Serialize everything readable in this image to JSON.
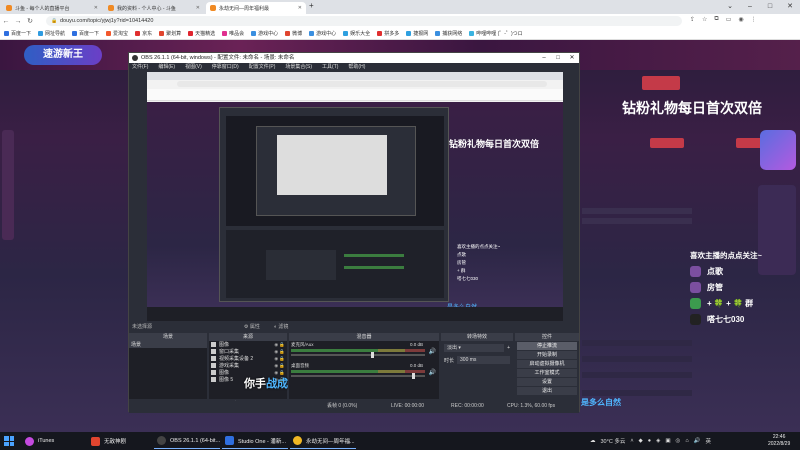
{
  "chrome": {
    "tabs": [
      {
        "title": "斗鱼 - 每个人的直播平台",
        "color": "#f08a24"
      },
      {
        "title": "我的资料 - 个人中心 - 斗鱼",
        "color": "#f08a24"
      },
      {
        "title": "永劫无间—周年福利最",
        "color": "#f08a24"
      }
    ],
    "new_tab": "+",
    "url": "douyu.com/topic/yjwj1y?rid=10414420",
    "bookmarks": [
      {
        "label": "百度一下",
        "color": "#2f6fe0"
      },
      {
        "label": "网址导航",
        "color": "#2f9be0"
      },
      {
        "label": "百度一下",
        "color": "#2f6fe0"
      },
      {
        "label": "爱淘宝",
        "color": "#f2582c"
      },
      {
        "label": "京东",
        "color": "#e02f2f"
      },
      {
        "label": "聚划算",
        "color": "#e0452f"
      },
      {
        "label": "天猫精选",
        "color": "#e0252f"
      },
      {
        "label": "唯品会",
        "color": "#e02f8f"
      },
      {
        "label": "游戏中心",
        "color": "#3a8fe0"
      },
      {
        "label": "微博",
        "color": "#e0452f"
      },
      {
        "label": "游戏中心",
        "color": "#3a8fe0"
      },
      {
        "label": "娱乐大全",
        "color": "#2fa0e0"
      },
      {
        "label": "拼多多",
        "color": "#e02f2f"
      },
      {
        "label": "捷报网",
        "color": "#2fa0e0"
      },
      {
        "label": "捕获网络",
        "color": "#3a8fe0"
      },
      {
        "label": "哔哩哔哩 (゜-゜)つロ",
        "color": "#3ab3e0"
      }
    ]
  },
  "douyu": {
    "logo": "速游新王",
    "banner": "钻粉礼物每日首次双倍",
    "panel_title": "喜欢主播的点点关注~",
    "panel_items": [
      "点歌",
      "房管",
      "+ 🍀 + 🍀 群",
      "嗒七七030"
    ],
    "watermark": "是多么自然"
  },
  "obs": {
    "title": "OBS 26.1.1 (64-bit, windows) - 配置文件: 未命名 - 场景: 未命名",
    "menu": [
      "文件(F)",
      "编辑(E)",
      "视图(V)",
      "停靠窗口(D)",
      "配置文件(P)",
      "场景集合(S)",
      "工具(T)",
      "帮助(H)"
    ],
    "preview_banner": "钻粉礼物每日首次双倍",
    "preview_panel": [
      "喜欢主播的点点关注~",
      "点歌",
      "房管",
      "+ 群",
      "嗒七七030"
    ],
    "preview_watermark": "是多么自然",
    "source_label": "未选择源",
    "toggle_props": "属性",
    "toggle_filters": "滤镜",
    "dock_titles": {
      "scenes": "场景",
      "sources": "来源",
      "mixer": "混音器",
      "transitions": "转场特效",
      "controls": "控件"
    },
    "scenes": [
      "场景"
    ],
    "sources": [
      "图像",
      "窗口采集",
      "视频采集设备 2",
      "游戏采集",
      "图像",
      "图像 5"
    ],
    "mixer": [
      {
        "name": "麦克风/Aux",
        "db": "0.0 dB",
        "level": 0.6
      },
      {
        "name": "桌面音频",
        "db": "0.0 dB",
        "level": 0.9
      }
    ],
    "transition": {
      "type": "淡出",
      "duration_label": "时长",
      "duration": "300 ms"
    },
    "controls": [
      "停止推流",
      "开始录制",
      "启动虚拟摄像机",
      "工作室模式",
      "设置",
      "退出"
    ],
    "status": {
      "live": "LIVE: 00:00:00",
      "rec": "REC: 00:00:00",
      "cpu": "CPU: 1.3%, 60.00 fps",
      "dropped": "丢帧 0 (0.0%)",
      "kbps": "kb/s: 0"
    },
    "subtitle_white": "你手",
    "subtitle_blue": "战成"
  },
  "taskbar": {
    "apps": [
      {
        "label": "iTunes",
        "color": "#c44ae0"
      },
      {
        "label": "无敌神剧",
        "color": "#e0452f"
      },
      {
        "label": "OBS 26.1.1 (64-bit...",
        "color": "#333333"
      },
      {
        "label": "Studio One - 潘新...",
        "color": "#2f6fe0"
      },
      {
        "label": "永劫无间—周年福...",
        "color": "#f0b724"
      }
    ],
    "weather": "30°C 多云",
    "ime": "英",
    "time": "22:46",
    "date": "2022/8/29"
  }
}
